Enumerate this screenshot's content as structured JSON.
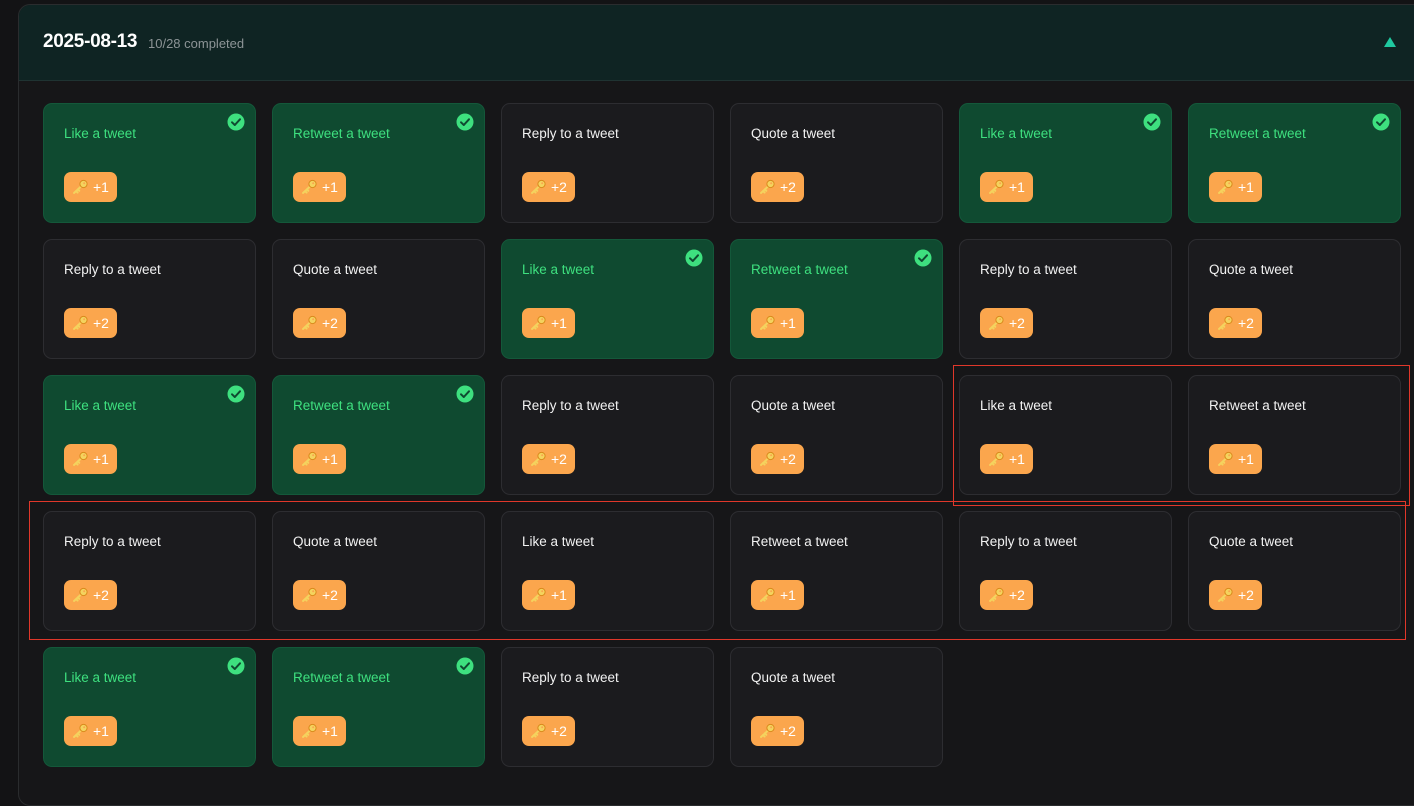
{
  "header": {
    "date": "2025-08-13",
    "progress": "10/28 completed"
  },
  "colors": {
    "done_card_bg": "#0f4a30",
    "done_title": "#3ee07f",
    "pending_card_bg": "#1b1b1e",
    "badge_bg": "#fba64d",
    "accent_toggle": "#1fc9a0",
    "highlight_border": "#e0372a"
  },
  "icons": {
    "collapse": "triangle-up-icon",
    "completed": "check-circle-icon",
    "reward": "key-icon"
  },
  "tasks": [
    {
      "title": "Like a tweet",
      "points": "+1",
      "completed": true
    },
    {
      "title": "Retweet a tweet",
      "points": "+1",
      "completed": true
    },
    {
      "title": "Reply to a tweet",
      "points": "+2",
      "completed": false
    },
    {
      "title": "Quote a tweet",
      "points": "+2",
      "completed": false
    },
    {
      "title": "Like a tweet",
      "points": "+1",
      "completed": true
    },
    {
      "title": "Retweet a tweet",
      "points": "+1",
      "completed": true
    },
    {
      "title": "Reply to a tweet",
      "points": "+2",
      "completed": false
    },
    {
      "title": "Quote a tweet",
      "points": "+2",
      "completed": false
    },
    {
      "title": "Like a tweet",
      "points": "+1",
      "completed": true
    },
    {
      "title": "Retweet a tweet",
      "points": "+1",
      "completed": true
    },
    {
      "title": "Reply to a tweet",
      "points": "+2",
      "completed": false
    },
    {
      "title": "Quote a tweet",
      "points": "+2",
      "completed": false
    },
    {
      "title": "Like a tweet",
      "points": "+1",
      "completed": true
    },
    {
      "title": "Retweet a tweet",
      "points": "+1",
      "completed": true
    },
    {
      "title": "Reply to a tweet",
      "points": "+2",
      "completed": false
    },
    {
      "title": "Quote a tweet",
      "points": "+2",
      "completed": false
    },
    {
      "title": "Like a tweet",
      "points": "+1",
      "completed": false
    },
    {
      "title": "Retweet a tweet",
      "points": "+1",
      "completed": false
    },
    {
      "title": "Reply to a tweet",
      "points": "+2",
      "completed": false
    },
    {
      "title": "Quote a tweet",
      "points": "+2",
      "completed": false
    },
    {
      "title": "Like a tweet",
      "points": "+1",
      "completed": false
    },
    {
      "title": "Retweet a tweet",
      "points": "+1",
      "completed": false
    },
    {
      "title": "Reply to a tweet",
      "points": "+2",
      "completed": false
    },
    {
      "title": "Quote a tweet",
      "points": "+2",
      "completed": false
    },
    {
      "title": "Like a tweet",
      "points": "+1",
      "completed": true
    },
    {
      "title": "Retweet a tweet",
      "points": "+1",
      "completed": true
    },
    {
      "title": "Reply to a tweet",
      "points": "+2",
      "completed": false
    },
    {
      "title": "Quote a tweet",
      "points": "+2",
      "completed": false
    }
  ]
}
